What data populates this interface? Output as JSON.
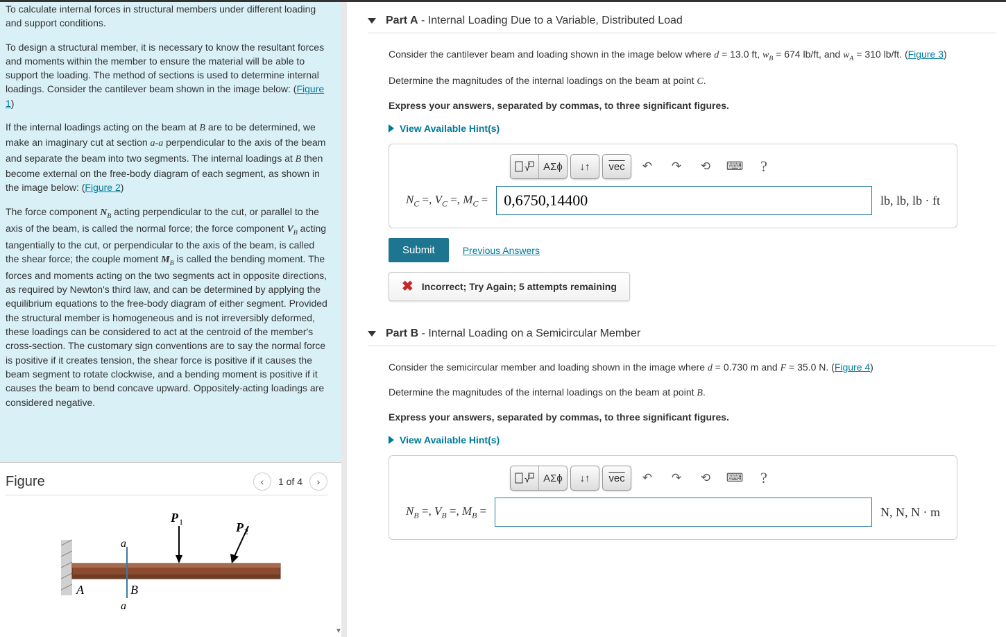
{
  "left": {
    "p1": "To calculate internal forces in structural members under different loading and support conditions.",
    "p2a": "To design a structural member, it is necessary to know the resultant forces and moments within the member to ensure the material will be able to support the loading. The method of sections is used to determine internal loadings. Consider the cantilever beam shown in the image below: (",
    "fig1": "Figure 1",
    "p3a": "If the internal loadings acting on the beam at ",
    "p3b": " are to be determined, we make an imaginary cut at section ",
    "p3c": " perpendicular to the axis of the beam and separate the beam into two segments. The internal loadings at ",
    "p3d": " then become external on the free-body diagram of each segment, as shown in the image below: (",
    "fig2": "Figure 2",
    "p4a": "The force component ",
    "p4b": " acting perpendicular to the cut, or parallel to the axis of the beam, is called the normal force; the force component ",
    "p4c": " acting tangentially to the cut, or perpendicular to the axis of the beam, is called the shear force; the couple moment ",
    "p4d": " is called the bending moment. The forces and moments acting on the two segments act in opposite directions, as required by Newton's third law, and can be determined by applying the equilibrium equations to the free-body diagram of either segment. Provided the structural member is homogeneous and is not irreversibly deformed, these loadings can be considered to act at the centroid of the member's cross-section. The customary sign conventions are to say the normal force is positive if it creates tension, the shear force is positive if it causes the beam segment to rotate clockwise, and a bending moment is positive if it causes the beam to bend concave upward. Oppositely-acting loadings are considered negative.",
    "figure_title": "Figure",
    "figure_counter": "1 of 4",
    "beam_labels": {
      "P1": "P",
      "P1s": "1",
      "P2": "P",
      "P2s": "2",
      "A": "A",
      "B": "B",
      "a1": "a",
      "a2": "a"
    }
  },
  "partA": {
    "title_strong": "Part A",
    "title_rest": " - Internal Loading Due to a Variable, Distributed Load",
    "problem": {
      "pre": "Consider the cantilever beam and loading shown in the image below where ",
      "d": "d = 13.0 ft",
      "wb": "w_B = 674 lb/ft",
      "wa": "w_A = 310 lb/ft",
      "post": ". (",
      "figlink": "Figure 3",
      "close": ")"
    },
    "determine": "Determine the magnitudes of the internal loadings on the beam at point C.",
    "express": "Express your answers, separated by commas, to three significant figures.",
    "hints": "View Available Hint(s)",
    "eq_label_parts": [
      "N",
      "C",
      " =, ",
      "V",
      "C",
      " =, ",
      "M",
      "C",
      " ="
    ],
    "input_value": "0,6750,14400",
    "units": "lb, lb, lb · ft",
    "submit": "Submit",
    "prev": "Previous Answers",
    "feedback": "Incorrect; Try Again; 5 attempts remaining"
  },
  "partB": {
    "title_strong": "Part B",
    "title_rest": " - Internal Loading on a Semicircular Member",
    "problem": {
      "pre": "Consider the semicircular member and loading shown in the image where ",
      "d": "d = 0.730 m",
      "f": "F = 35.0 N",
      "post": ". (",
      "figlink": "Figure 4",
      "close": ")"
    },
    "determine": "Determine the magnitudes of the internal loadings on the beam at point B.",
    "express": "Express your answers, separated by commas, to three significant figures.",
    "hints": "View Available Hint(s)",
    "eq_label_parts": [
      "N",
      "B",
      " =, ",
      "V",
      "B",
      " =, ",
      "M",
      "B",
      " ="
    ],
    "input_value": "",
    "units": "N, N, N · m"
  },
  "toolbar": {
    "templates": "▯√▯",
    "greek": "ΑΣϕ",
    "arrows": "↓↑",
    "vec": "vec",
    "undo": "↶",
    "redo": "↷",
    "reset": "⟲",
    "keyboard": "⌨",
    "help": "?"
  }
}
